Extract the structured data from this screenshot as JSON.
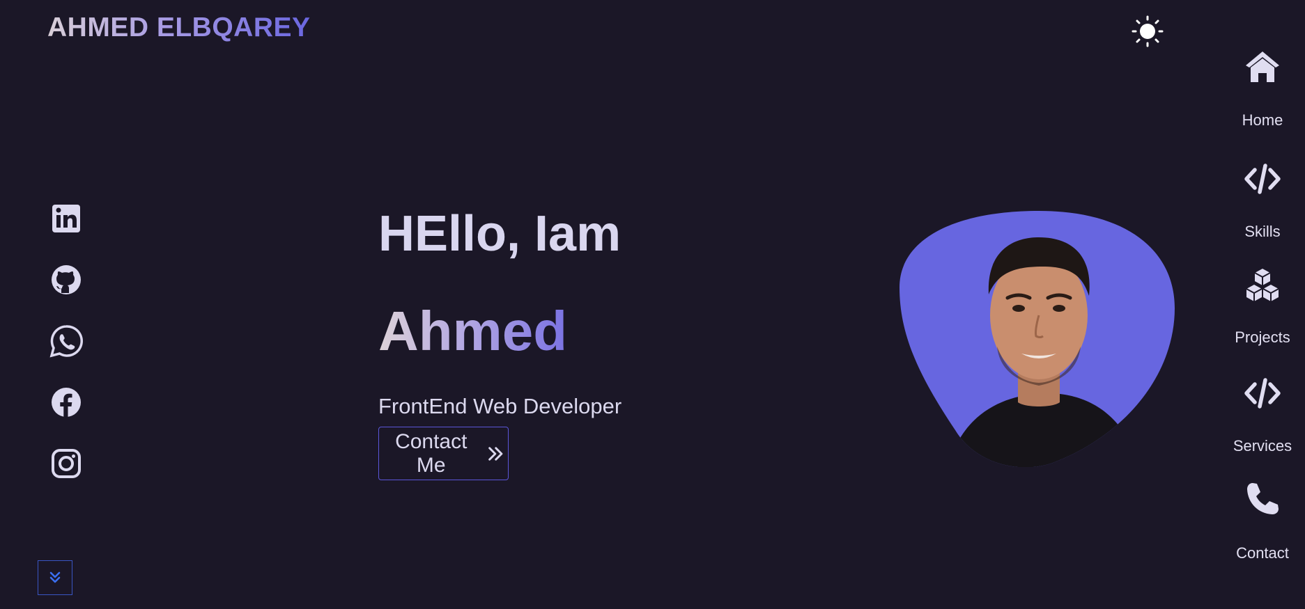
{
  "header": {
    "logo": "AHMED ELBQAREY",
    "theme_toggle_icon": "sun-icon"
  },
  "social": {
    "links": [
      {
        "name": "linkedin",
        "icon": "linkedin-icon"
      },
      {
        "name": "github",
        "icon": "github-icon"
      },
      {
        "name": "whatsapp",
        "icon": "whatsapp-icon"
      },
      {
        "name": "facebook",
        "icon": "facebook-icon"
      },
      {
        "name": "instagram",
        "icon": "instagram-icon"
      }
    ]
  },
  "hero": {
    "greeting": "HEllo, Iam",
    "name": "Ahmed",
    "role": "FrontEnd Web Developer",
    "contact_label": "Contact Me"
  },
  "nav": {
    "items": [
      {
        "label": "Home",
        "icon": "home-icon"
      },
      {
        "label": "Skills",
        "icon": "code-icon"
      },
      {
        "label": "Projects",
        "icon": "cubes-icon"
      },
      {
        "label": "Services",
        "icon": "code-icon"
      },
      {
        "label": "Contact",
        "icon": "phone-icon"
      }
    ]
  },
  "colors": {
    "background": "#1b1727",
    "accent": "#6766e0",
    "text": "#dcd9ef",
    "scroll_button_border": "#3a56c4"
  }
}
